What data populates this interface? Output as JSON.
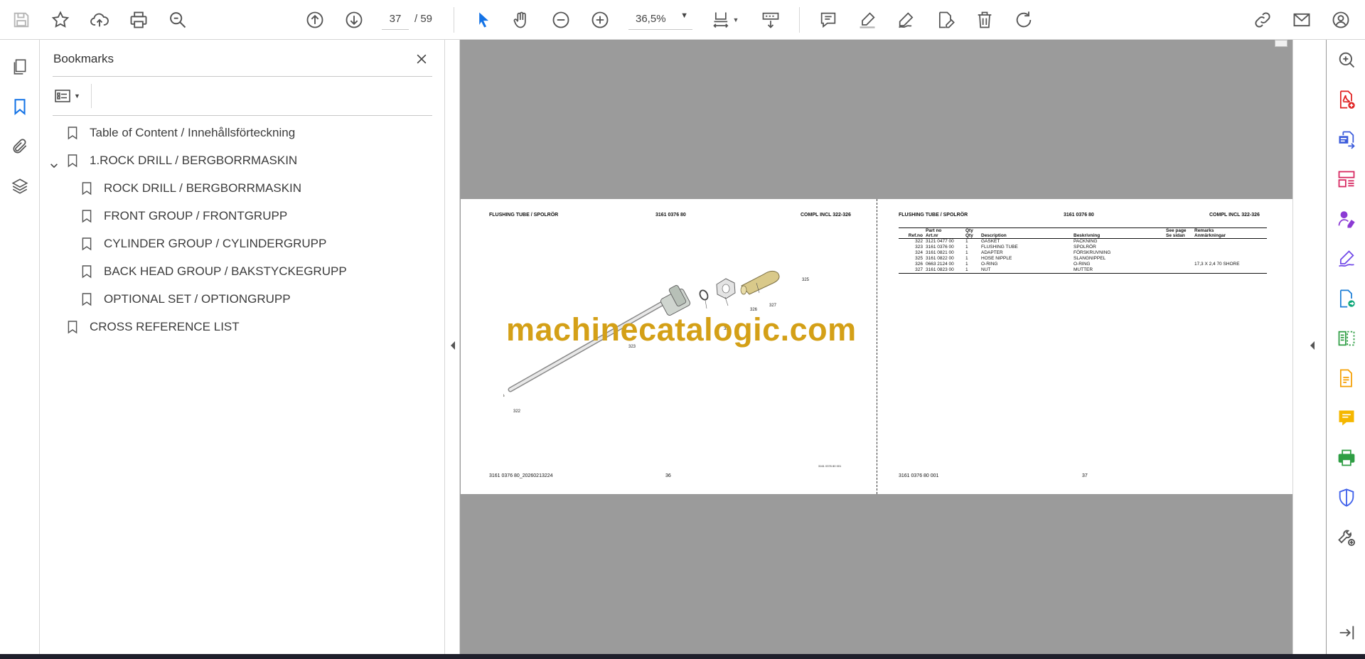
{
  "toolbar": {
    "page_current": "37",
    "page_total": "/ 59",
    "zoom_value": "36,5%"
  },
  "bookmarks_panel": {
    "title": "Bookmarks",
    "items": [
      {
        "label": "Table of Content / Innehållsförteckning",
        "level": 0
      },
      {
        "label": "1.ROCK DRILL / BERGBORRMASKIN",
        "level": 0,
        "expanded": true
      },
      {
        "label": "ROCK DRILL / BERGBORRMASKIN",
        "level": 1
      },
      {
        "label": "FRONT GROUP / FRONTGRUPP",
        "level": 1
      },
      {
        "label": "CYLINDER GROUP / CYLINDERGRUPP",
        "level": 1
      },
      {
        "label": "BACK HEAD GROUP / BAKSTYCKEGRUPP",
        "level": 1
      },
      {
        "label": "OPTIONAL SET / OPTIONGRUPP",
        "level": 1
      },
      {
        "label": "CROSS REFERENCE LIST",
        "level": 0
      }
    ]
  },
  "document": {
    "watermark": "machinecatalogic.com",
    "left_page": {
      "header_title": "FLUSHING TUBE / SPOLRÖR",
      "header_part": "3161 0376 80",
      "header_compl": "COMPL INCL 322-326",
      "callouts": [
        "322",
        "323",
        "324",
        "325",
        "326",
        "327"
      ],
      "footer_left": "3161 0376 80_20260213224",
      "footer_page": "36",
      "footer_small": "3161 0376 80 001"
    },
    "right_page": {
      "header_title": "FLUSHING TUBE / SPOLRÖR",
      "header_part": "3161 0376 80",
      "header_compl": "COMPL INCL 322-326",
      "columns": [
        [
          "Ref.no",
          ""
        ],
        [
          "Part no",
          "Art.nr"
        ],
        [
          "Qty",
          "Qty"
        ],
        [
          "Description",
          ""
        ],
        [
          "Beskrivning",
          ""
        ],
        [
          "See page",
          "Se sidan"
        ],
        [
          "Remarks",
          "Anmärkningar"
        ]
      ],
      "rows": [
        [
          "322",
          "3121 0477 00",
          "1",
          "GASKET",
          "PACKNING",
          "",
          ""
        ],
        [
          "323",
          "3161 0376 00",
          "1",
          "FLUSHING TUBE",
          "SPOLRÖR",
          "",
          ""
        ],
        [
          "324",
          "3161 0821 00",
          "1",
          "ADAPTER",
          "FÖRSKRUVNING",
          "",
          ""
        ],
        [
          "325",
          "3161 0822 00",
          "1",
          "HOSE NIPPLE",
          "SLANGNIPPEL",
          "",
          ""
        ],
        [
          "326",
          "0663 2124 00",
          "1",
          "O-RING",
          "O-RING",
          "",
          "17,3 X 2,4 70 SHORE"
        ],
        [
          "327",
          "3161 0823 00",
          "1",
          "NUT",
          "MUTTER",
          "",
          ""
        ]
      ],
      "footer_left": "3161 0376 80 001",
      "footer_page": "37"
    }
  },
  "colors": {
    "accent_blue": "#1473e6",
    "viewer_bg": "#9b9b9b",
    "watermark": "#d4a017"
  }
}
